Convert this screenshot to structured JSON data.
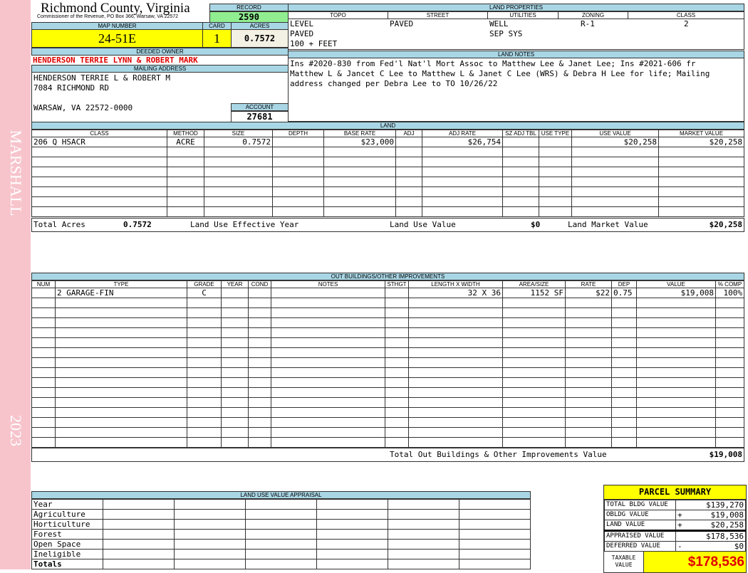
{
  "sidebar": {
    "name": "MARSHALL",
    "year": "2023"
  },
  "header": {
    "title": "Richmond County, Virginia",
    "subtitle": "Commissioner of the Revenue, PO Box 366, Warsaw, VA 22572"
  },
  "record": {
    "label": "RECORD",
    "value": "2590"
  },
  "map": {
    "map_label": "MAP NUMBER",
    "map_value": "24-51E",
    "card_label": "CARD",
    "card_value": "1",
    "acres_label": "ACRES",
    "acres_value": "0.7572"
  },
  "owner": {
    "label": "DEEDED OWNER",
    "value": "HENDERSON TERRIE LYNN & ROBERT MARK"
  },
  "mailing": {
    "label": "MAILING ADDRESS",
    "lines": [
      "HENDERSON TERRIE L & ROBERT M",
      "7084 RICHMOND RD",
      "",
      "WARSAW, VA 22572-0000"
    ]
  },
  "account": {
    "label": "ACCOUNT",
    "value": "27681"
  },
  "land_properties": {
    "label": "LAND PROPERTIES",
    "headers": [
      "TOPO",
      "STREET",
      "UTILITIES",
      "ZONING",
      "CLASS"
    ],
    "rows": [
      [
        "LEVEL",
        "PAVED",
        "WELL",
        "R-1",
        "2"
      ],
      [
        "PAVED",
        "",
        "SEP SYS",
        "",
        ""
      ],
      [
        "100 + FEET",
        "",
        "",
        "",
        ""
      ]
    ]
  },
  "land_notes": {
    "label": "LAND NOTES",
    "text": "Ins #2020-830 from Fed'l Nat'l Mort Assoc to Matthew Lee & Janet Lee; Ins #2021-606 fr Matthew L & Jancet C Lee to Matthew L & Janet C Lee (WRS) & Debra H Lee for life; Mailing address changed per Debra Lee to TO 10/26/22"
  },
  "land": {
    "label": "LAND",
    "headers": [
      "CLASS",
      "METHOD",
      "SIZE",
      "DEPTH",
      "BASE RATE",
      "ADJ",
      "ADJ RATE",
      "SZ ADJ TBL",
      "USE TYPE",
      "USE VALUE",
      "MARKET VALUE"
    ],
    "rows": [
      [
        "206 Q HSACR",
        "ACRE",
        "0.7572",
        "",
        "$23,000",
        "",
        "$26,754",
        "",
        "",
        "$20,258",
        "$20,258"
      ]
    ],
    "totals": {
      "acres_label": "Total Acres",
      "acres": "0.7572",
      "eff_year_label": "Land Use Effective Year",
      "eff_year": "",
      "use_value_label": "Land Use Value",
      "use_value": "$0",
      "market_label": "Land Market Value",
      "market": "$20,258"
    }
  },
  "outbuildings": {
    "label": "OUT BUILDINGS/OTHER IMPROVEMENTS",
    "headers": [
      "NUM",
      "TYPE",
      "GRADE",
      "YEAR",
      "COND",
      "NOTES",
      "STHGT",
      "LENGTH X WIDTH",
      "AREA/SIZE",
      "RATE",
      "DEP",
      "VALUE",
      "% COMP"
    ],
    "rows": [
      [
        "",
        "2 GARAGE-FIN",
        "C",
        "",
        "",
        "",
        "",
        "32 X 36",
        "1152 SF",
        "$22",
        "0.75",
        "$19,008",
        "100%"
      ]
    ],
    "total_label": "Total Out Buildings & Other Improvements Value",
    "total": "$19,008"
  },
  "land_use_appraisal": {
    "label": "LAND USE VALUE APPRAISAL",
    "rows": [
      "Year",
      "Agriculture",
      "Horticulture",
      "Forest",
      "Open Space",
      "Ineligible",
      "Totals"
    ]
  },
  "parcel_summary": {
    "title": "PARCEL SUMMARY",
    "rows": [
      {
        "label": "TOTAL BLDG VALUE",
        "op": "",
        "value": "$139,270"
      },
      {
        "label": "OBLDG VALUE",
        "op": "+",
        "value": "$19,008"
      },
      {
        "label": "LAND VALUE",
        "op": "+",
        "value": "$20,258"
      },
      {
        "label": "APPRAISED VALUE",
        "op": "",
        "value": "$178,536"
      },
      {
        "label": "DEFERRED VALUE",
        "op": "-",
        "value": "$0"
      }
    ],
    "taxable_label": "TAXABLE VALUE",
    "taxable": "$178,536"
  },
  "colors": {
    "header_blue": "#a9d6e5",
    "yellow": "#ffff00",
    "green": "#90ee90",
    "owner_red": "#e00000",
    "sidebar_pink": "#f7c4cc"
  }
}
